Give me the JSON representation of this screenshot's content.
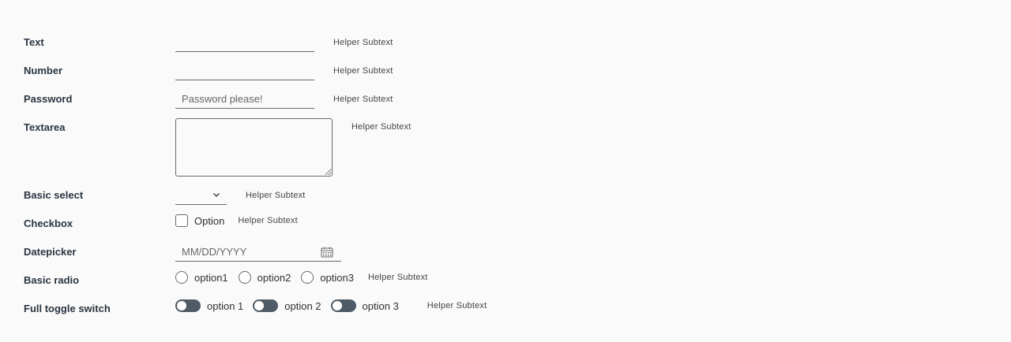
{
  "fields": {
    "text": {
      "label": "Text",
      "value": "",
      "helper": "Helper Subtext"
    },
    "number": {
      "label": "Number",
      "value": "",
      "helper": "Helper Subtext"
    },
    "password": {
      "label": "Password",
      "placeholder": "Password please!",
      "helper": "Helper Subtext"
    },
    "textarea": {
      "label": "Textarea",
      "value": "",
      "helper": "Helper Subtext"
    },
    "select": {
      "label": "Basic select",
      "value": "",
      "helper": "Helper Subtext"
    },
    "checkbox": {
      "label": "Checkbox",
      "option": "Option",
      "checked": false,
      "helper": "Helper Subtext"
    },
    "datepicker": {
      "label": "Datepicker",
      "placeholder": "MM/DD/YYYY",
      "helper": "Helper Subtext"
    },
    "radio": {
      "label": "Basic radio",
      "options": [
        "option1",
        "option2",
        "option3"
      ],
      "helper": "Helper Subtext"
    },
    "toggle": {
      "label": "Full toggle switch",
      "options": [
        "option 1",
        "option 2",
        "option 3"
      ],
      "helper": "Helper Subtext"
    }
  },
  "icons": {
    "select": "chevron-down-icon",
    "datepicker": "calendar-icon"
  },
  "colors": {
    "label": "#2a3540",
    "toggle_track": "#4f5b66",
    "border": "#6a6a6a"
  }
}
